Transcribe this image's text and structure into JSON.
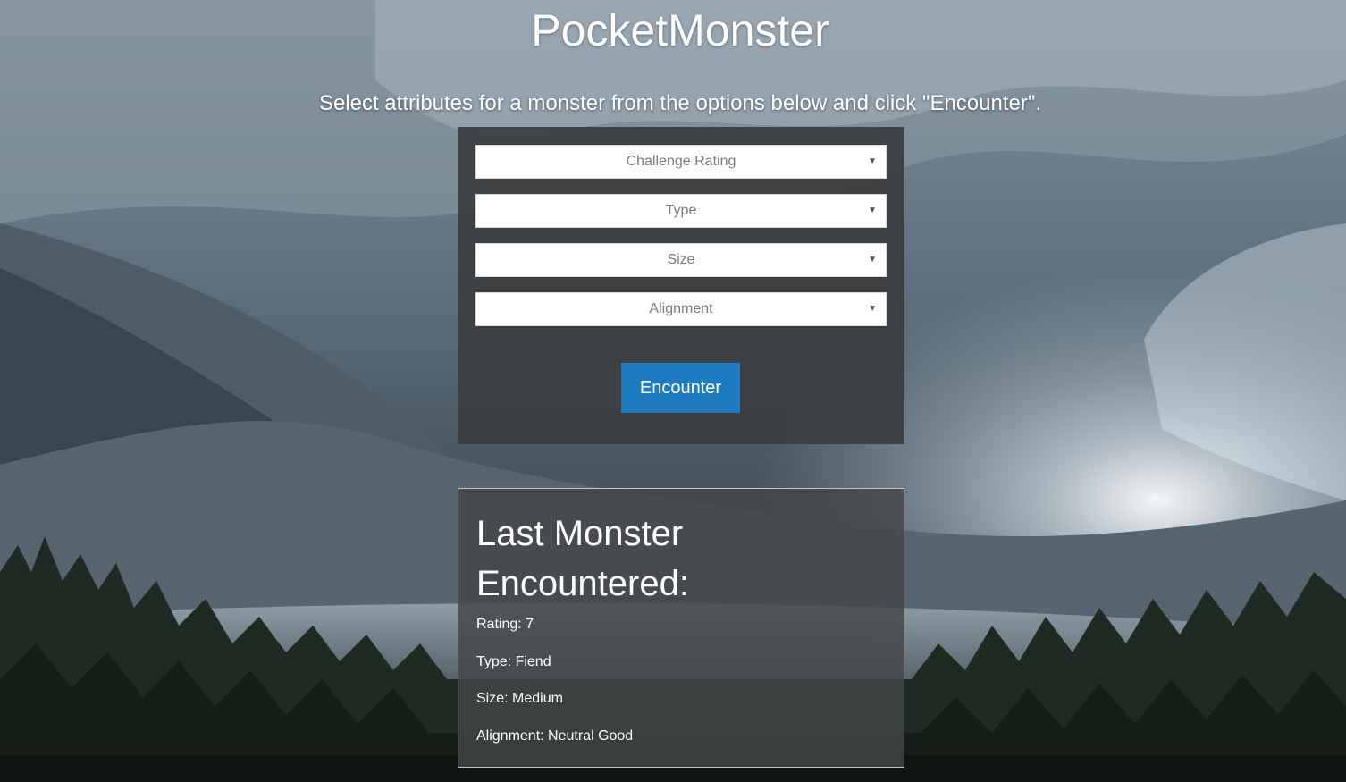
{
  "header": {
    "title": "PocketMonster",
    "subtitle": "Select attributes for a monster from the options below and click \"Encounter\"."
  },
  "form": {
    "selects": [
      {
        "placeholder": "Challenge Rating",
        "icon": "chevron-down-icon"
      },
      {
        "placeholder": "Type",
        "icon": "chevron-down-icon"
      },
      {
        "placeholder": "Size",
        "icon": "chevron-down-icon"
      },
      {
        "placeholder": "Alignment",
        "icon": "chevron-down-icon"
      }
    ],
    "encounter_label": "Encounter",
    "button_color": "#1f7bc1"
  },
  "last_monster": {
    "heading": "Last Monster Encountered:",
    "rating": "Rating: 7",
    "type": "Type: Fiend",
    "size": "Size: Medium",
    "alignment": "Alignment: Neutral Good"
  },
  "arrow_glyph": "▼"
}
